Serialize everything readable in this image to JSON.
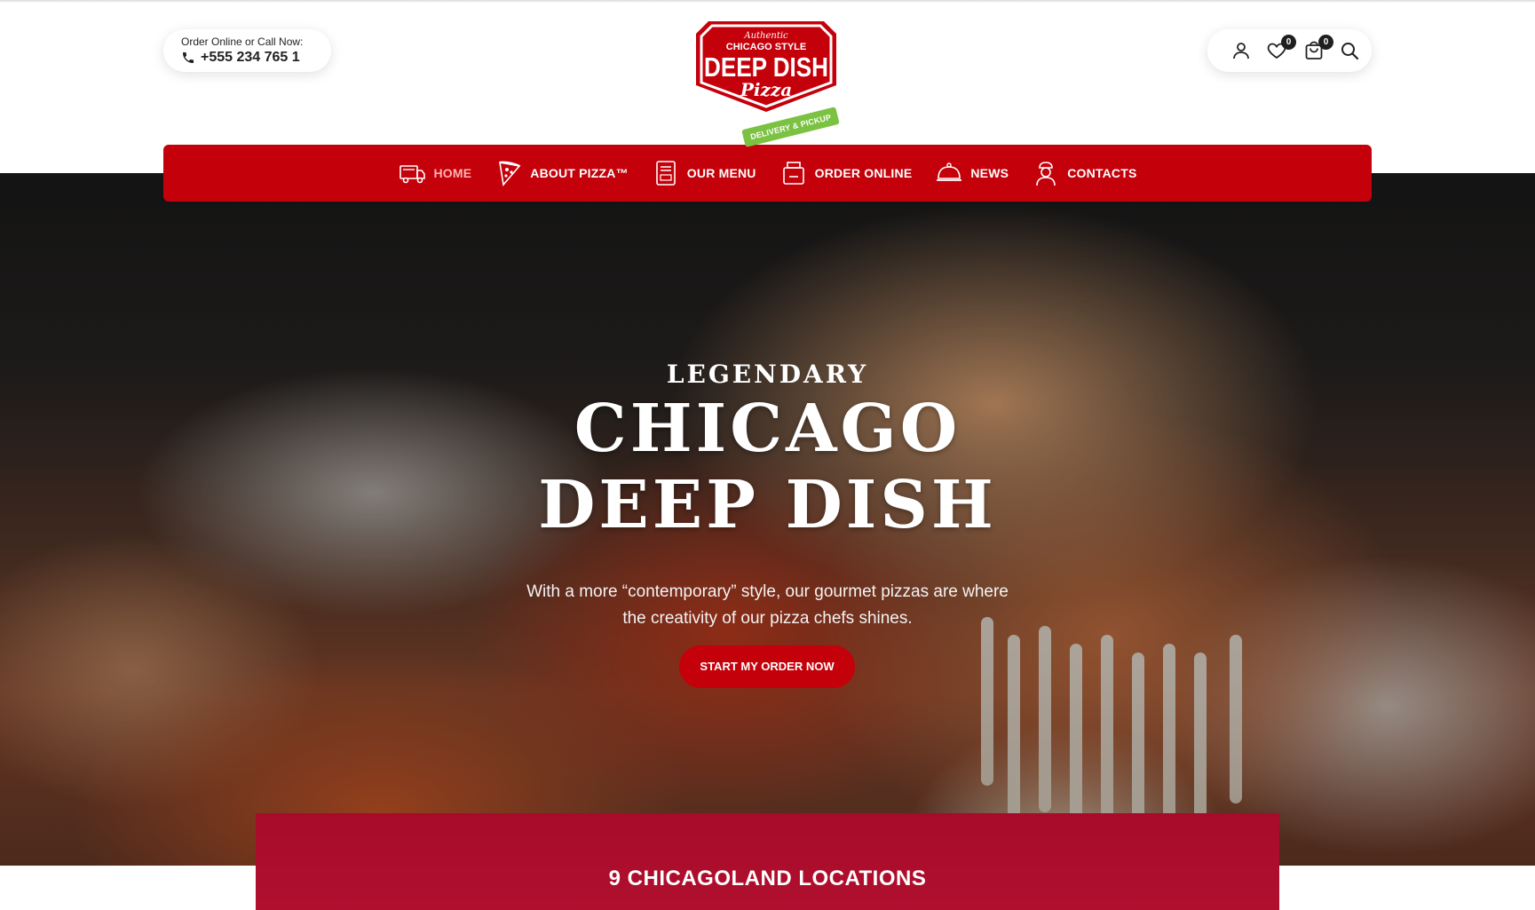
{
  "header": {
    "phone_label": "Order Online or Call Now:",
    "phone_number": "+555 234 765 1",
    "logo": {
      "line1": "Authentic",
      "line2": "CHICAGO STYLE",
      "line3": "DEEP DISH",
      "line4": "Pizza"
    },
    "wishlist_count": "0",
    "cart_count": "0"
  },
  "nav": {
    "items": [
      {
        "label": "HOME",
        "icon": "food-truck-icon"
      },
      {
        "label": "ABOUT PIZZA™",
        "icon": "pizza-slice-icon"
      },
      {
        "label": "OUR MENU",
        "icon": "menu-card-icon"
      },
      {
        "label": "ORDER ONLINE",
        "icon": "pizza-box-icon",
        "tag": "DELIVERY & PICKUP"
      },
      {
        "label": "NEWS",
        "icon": "cloche-icon"
      },
      {
        "label": "CONTACTS",
        "icon": "chef-icon"
      }
    ]
  },
  "hero": {
    "kicker": "LEGENDARY",
    "title_line1": "CHICAGO",
    "title_line2": "DEEP DISH",
    "subtitle": "With a more “contemporary” style, our gourmet pizzas are where the creativity of our pizza chefs shines.",
    "cta": "START MY ORDER NOW"
  },
  "locations": {
    "title": "9 CHICAGOLAND LOCATIONS"
  },
  "colors": {
    "brand_red": "#c4000a",
    "tag_green": "#7cc242",
    "panel_red": "#a80a2a"
  }
}
